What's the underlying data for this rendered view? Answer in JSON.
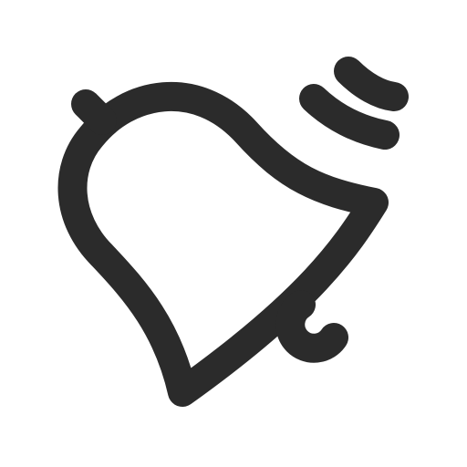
{
  "icon": {
    "name": "ringing-bell-icon",
    "stroke_color": "#2b2b2b",
    "background_color": "#ffffff"
  }
}
